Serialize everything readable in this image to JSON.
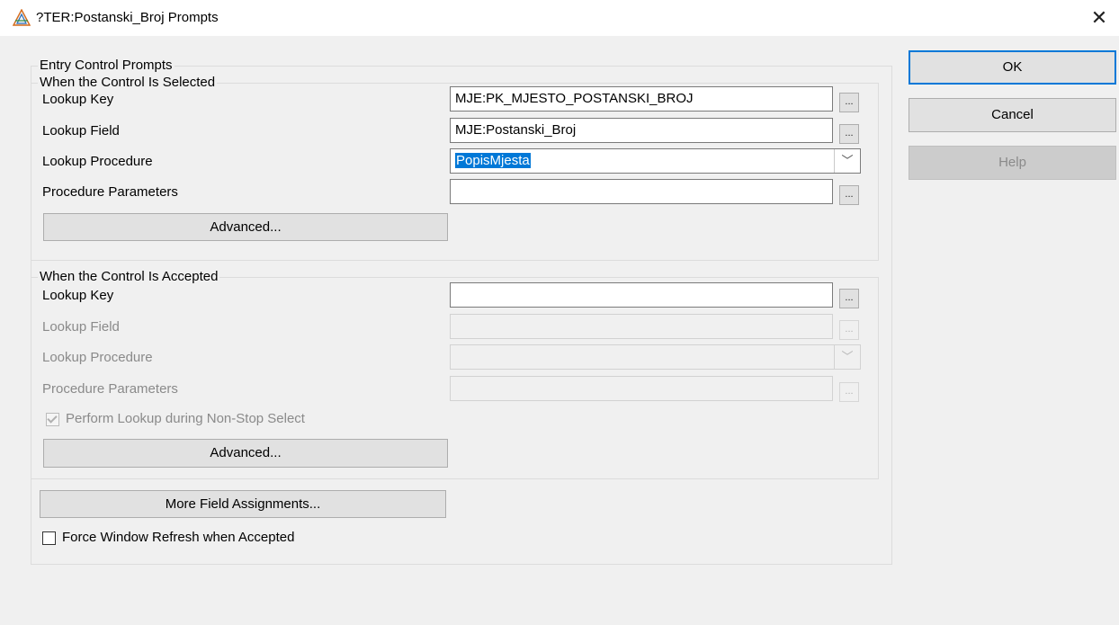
{
  "window": {
    "title": "?TER:Postanski_Broj Prompts",
    "close_glyph": "✕"
  },
  "entry_group": {
    "legend": "Entry Control Prompts"
  },
  "selected": {
    "legend": "When the Control Is Selected",
    "lookup_key_label": "Lookup Key",
    "lookup_key_value": "MJE:PK_MJESTO_POSTANSKI_BROJ",
    "lookup_field_label": "Lookup Field",
    "lookup_field_value": "MJE:Postanski_Broj",
    "lookup_procedure_label": "Lookup Procedure",
    "lookup_procedure_value": "PopisMjesta",
    "procedure_parameters_label": "Procedure Parameters",
    "procedure_parameters_value": "",
    "advanced_label": "Advanced..."
  },
  "accepted": {
    "legend": "When the Control Is Accepted",
    "lookup_key_label": "Lookup Key",
    "lookup_key_value": "",
    "lookup_field_label": "Lookup Field",
    "lookup_field_value": "",
    "lookup_procedure_label": "Lookup Procedure",
    "lookup_procedure_value": "",
    "procedure_parameters_label": "Procedure Parameters",
    "procedure_parameters_value": "",
    "perform_lookup_label": "Perform Lookup during Non-Stop Select",
    "perform_lookup_checked": true,
    "advanced_label": "Advanced..."
  },
  "more_field_assignments_label": "More Field Assignments...",
  "force_refresh_label": "Force Window Refresh when Accepted",
  "force_refresh_checked": false,
  "buttons": {
    "ok": "OK",
    "cancel": "Cancel",
    "help": "Help"
  },
  "ellipsis": "...",
  "dropdown_glyph": "﹀",
  "colors": {
    "accent": "#0078d7",
    "window_bg": "#f0f0f0",
    "disabled_text": "#8a8a8a"
  }
}
